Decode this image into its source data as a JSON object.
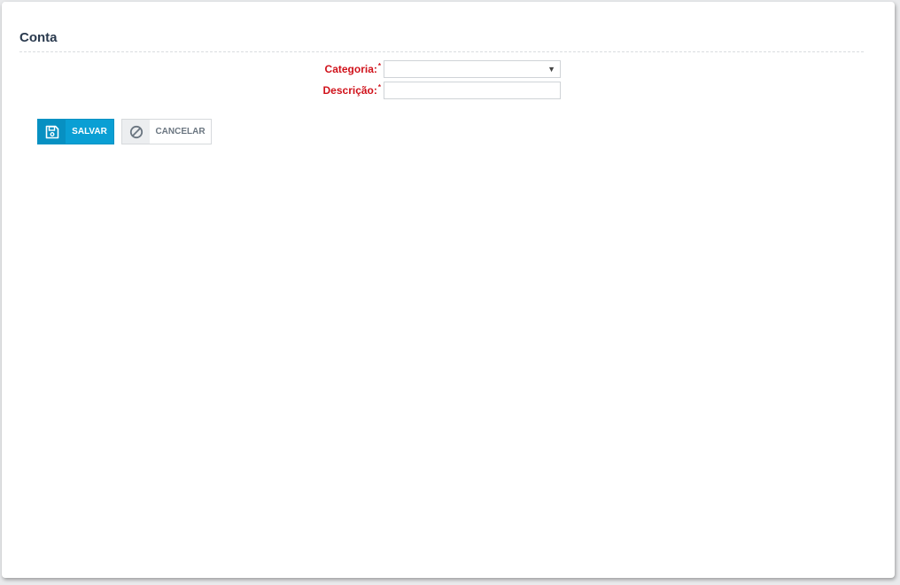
{
  "page": {
    "title": "Conta"
  },
  "form": {
    "categoria": {
      "label": "Categoria:",
      "required_mark": "*",
      "value": ""
    },
    "descricao": {
      "label": "Descrição:",
      "required_mark": "*",
      "value": ""
    }
  },
  "actions": {
    "save_label": "SALVAR",
    "cancel_label": "CANCELAR"
  },
  "icons": {
    "save": "floppy-disk-icon",
    "cancel": "ban-icon",
    "select_arrow": "caret-down-icon"
  },
  "colors": {
    "primary": "#0a9fd4",
    "required_label": "#d0121b",
    "title": "#2a3a4e"
  }
}
